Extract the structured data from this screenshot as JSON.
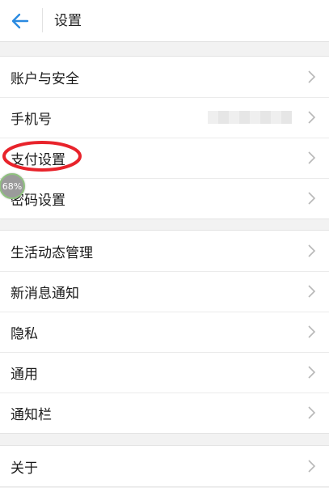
{
  "header": {
    "title": "设置",
    "accent_color": "#2a8ae0"
  },
  "groups": [
    {
      "items": [
        {
          "label": "账户与安全"
        },
        {
          "label": "手机号",
          "value_hidden": true
        },
        {
          "label": "支付设置",
          "highlighted": true
        },
        {
          "label": "密码设置"
        }
      ]
    },
    {
      "items": [
        {
          "label": "生活动态管理"
        },
        {
          "label": "新消息通知"
        },
        {
          "label": "隐私"
        },
        {
          "label": "通用"
        },
        {
          "label": "通知栏"
        }
      ]
    },
    {
      "items": [
        {
          "label": "关于"
        }
      ]
    }
  ],
  "annotation": {
    "color": "#e8232b"
  },
  "float_ball": {
    "percent_label": "68%",
    "border_color": "#8fc27f"
  }
}
